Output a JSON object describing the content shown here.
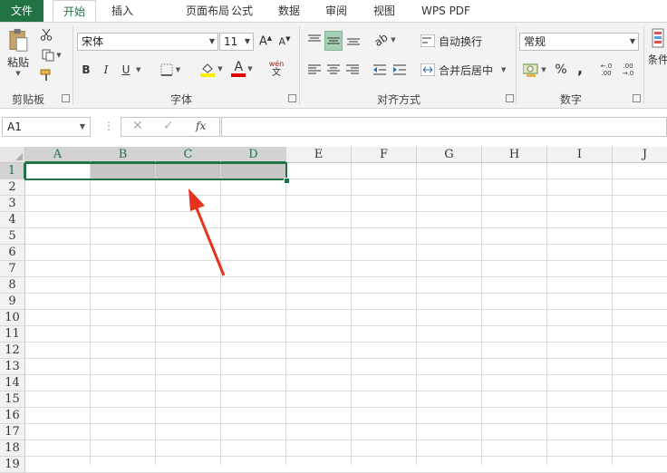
{
  "menu": {
    "file": "文件",
    "tabs": [
      "开始",
      "插入",
      "页面布局",
      "公式",
      "数据",
      "审阅",
      "视图",
      "WPS PDF"
    ],
    "active_index": 0
  },
  "ribbon": {
    "clipboard": {
      "paste_label": "粘贴",
      "group_label": "剪贴板"
    },
    "font": {
      "font_name": "宋体",
      "font_size": "11",
      "bold": "B",
      "italic": "I",
      "underline": "U",
      "font_color_glyph": "A",
      "phonetic_glyph": "wén",
      "group_label": "字体"
    },
    "alignment": {
      "wrap_text": "自动换行",
      "merge_center": "合并后居中",
      "group_label": "对齐方式"
    },
    "number": {
      "format": "常规",
      "percent": "%",
      "comma": ",",
      "group_label": "数字"
    },
    "styles": {
      "conditional_label": "条件"
    }
  },
  "formula_bar": {
    "name_box": "A1",
    "fx": "fx",
    "value": ""
  },
  "sheet": {
    "columns": [
      "A",
      "B",
      "C",
      "D",
      "E",
      "F",
      "G",
      "H",
      "I",
      "J"
    ],
    "rows": [
      "1",
      "2",
      "3",
      "4",
      "5",
      "6",
      "7",
      "8",
      "9",
      "10",
      "11",
      "12",
      "13",
      "14",
      "15",
      "16",
      "17",
      "18",
      "19"
    ],
    "selected_range": "A1:D1",
    "active_cell": "A1"
  },
  "colors": {
    "accent": "#217346",
    "selection_fill": "#c6c6c6",
    "annotation_arrow": "#e8321e"
  }
}
